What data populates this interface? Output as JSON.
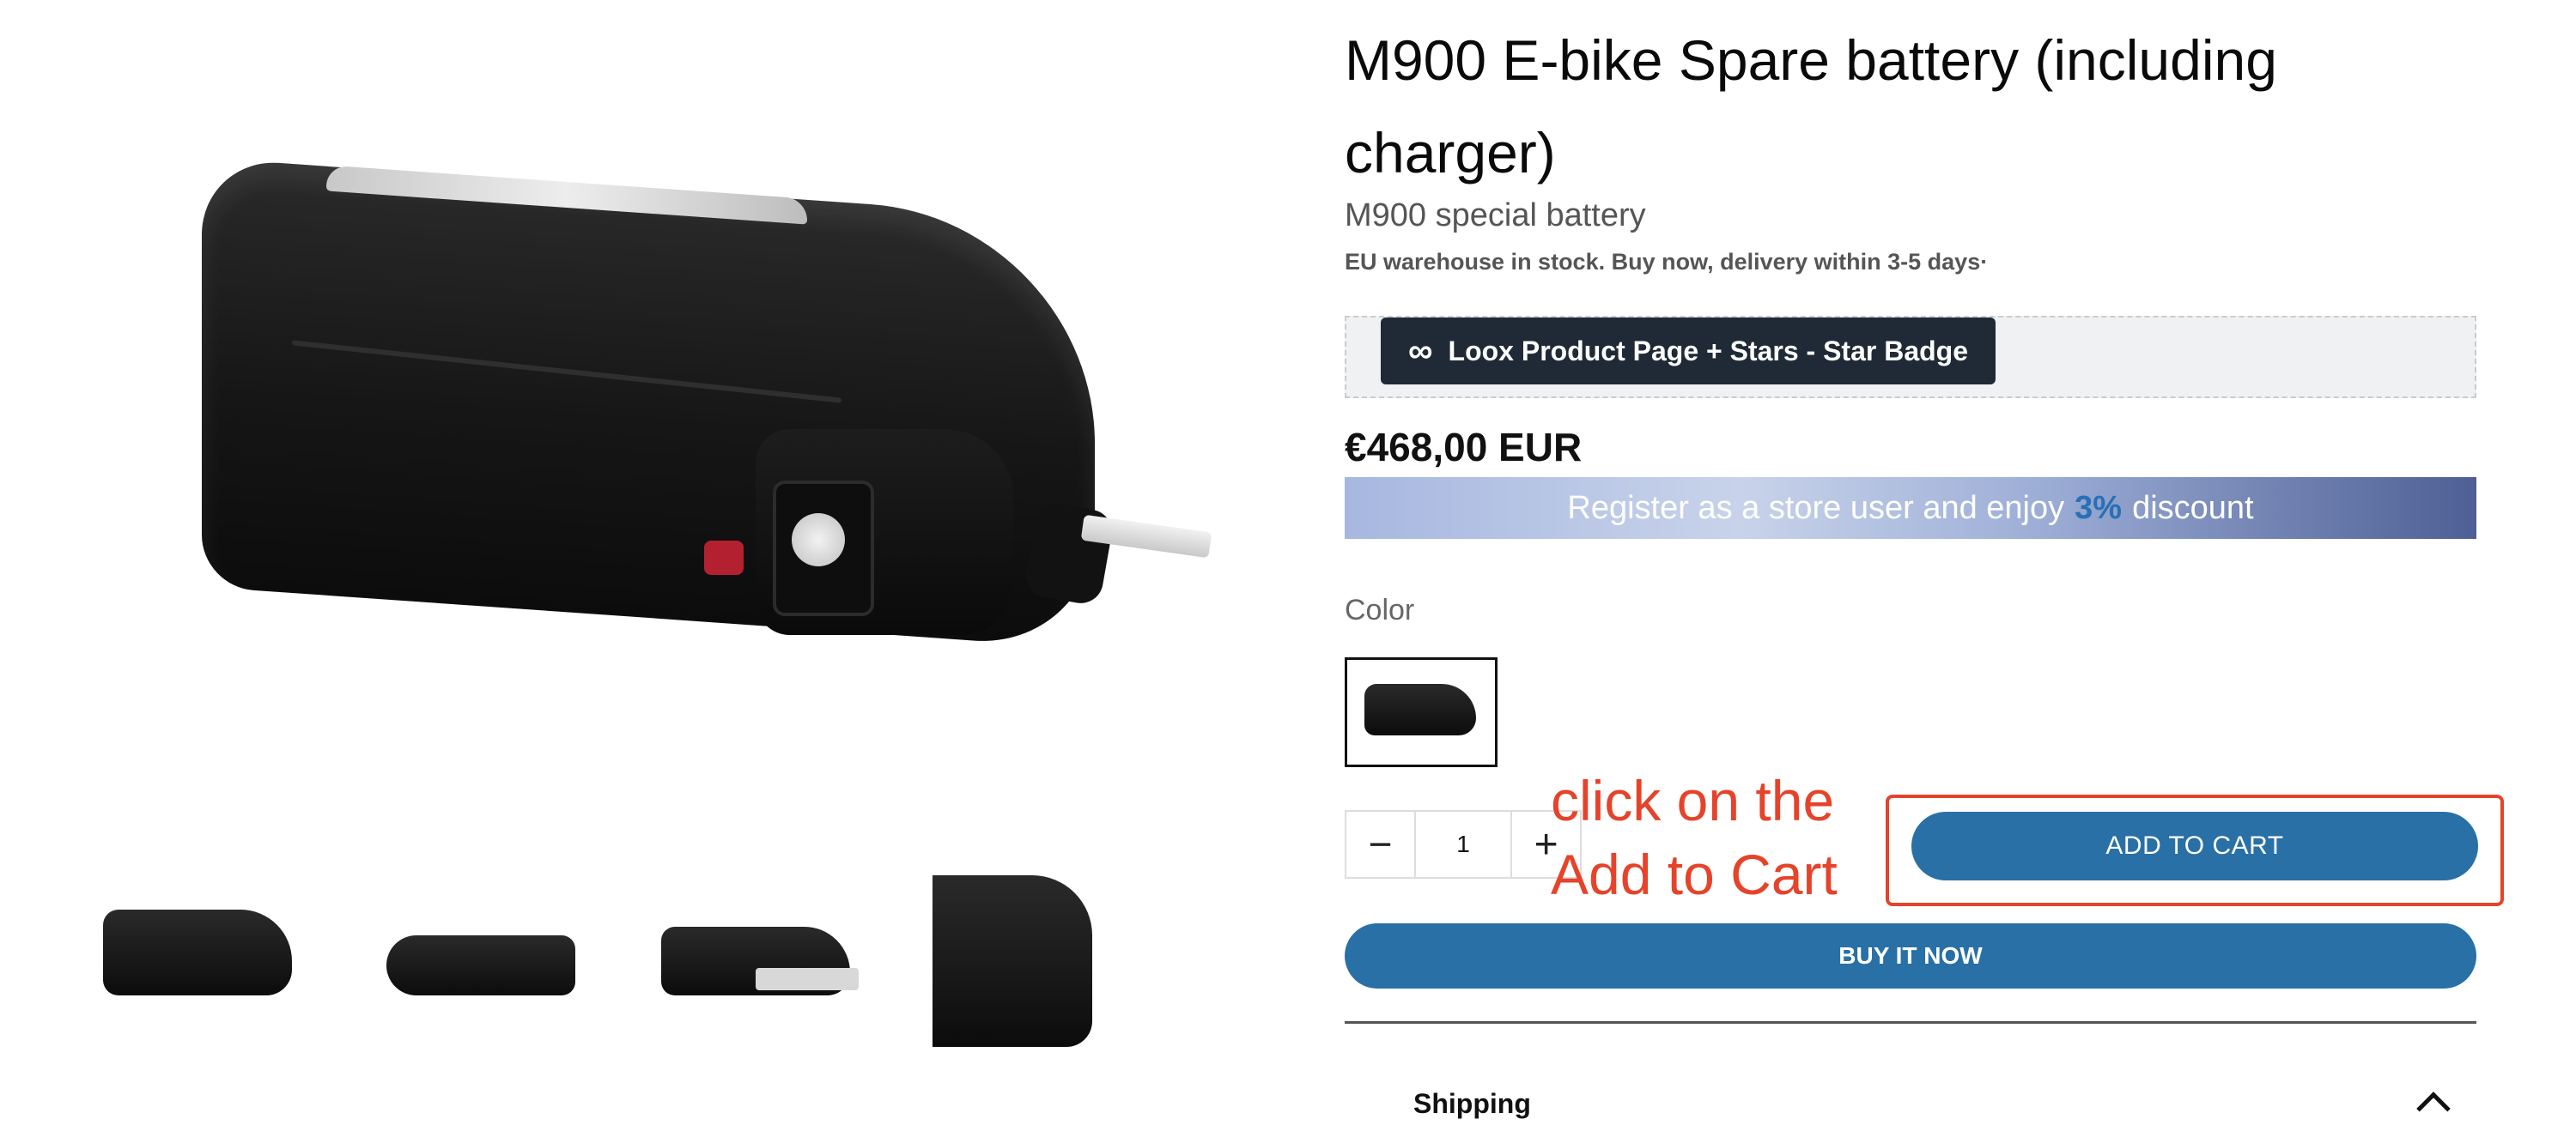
{
  "product": {
    "title": "M900 E-bike Spare battery (including charger)",
    "subtitle": "M900 special battery",
    "stock_notice": "EU warehouse in stock. Buy now, delivery within 3-5 days·",
    "price": "€468,00 EUR"
  },
  "reviews_widget": {
    "icon": "infinity-icon",
    "label": "Loox Product Page + Stars - Star Badge"
  },
  "promo": {
    "text_before": "Register as a store user and enjoy",
    "highlight": "3%",
    "text_after": "discount",
    "highlight_color": "#2870b6"
  },
  "options": {
    "color_label": "Color",
    "selected_color_index": 0
  },
  "quantity": {
    "value": "1",
    "minus_icon": "minus-icon",
    "plus_icon": "plus-icon"
  },
  "actions": {
    "add_to_cart": "ADD TO CART",
    "buy_now": "BUY IT NOW"
  },
  "annotation": {
    "text": "click on the Add to Cart",
    "color": "#e5432a"
  },
  "accordion": {
    "shipping_label": "Shipping",
    "shipping_expanded": true
  },
  "images": {
    "main_alt": "black e-bike battery with key",
    "thumbnail_count": 4
  },
  "colors": {
    "button_primary": "#2870a6",
    "badge_bg": "#1f2a36"
  }
}
